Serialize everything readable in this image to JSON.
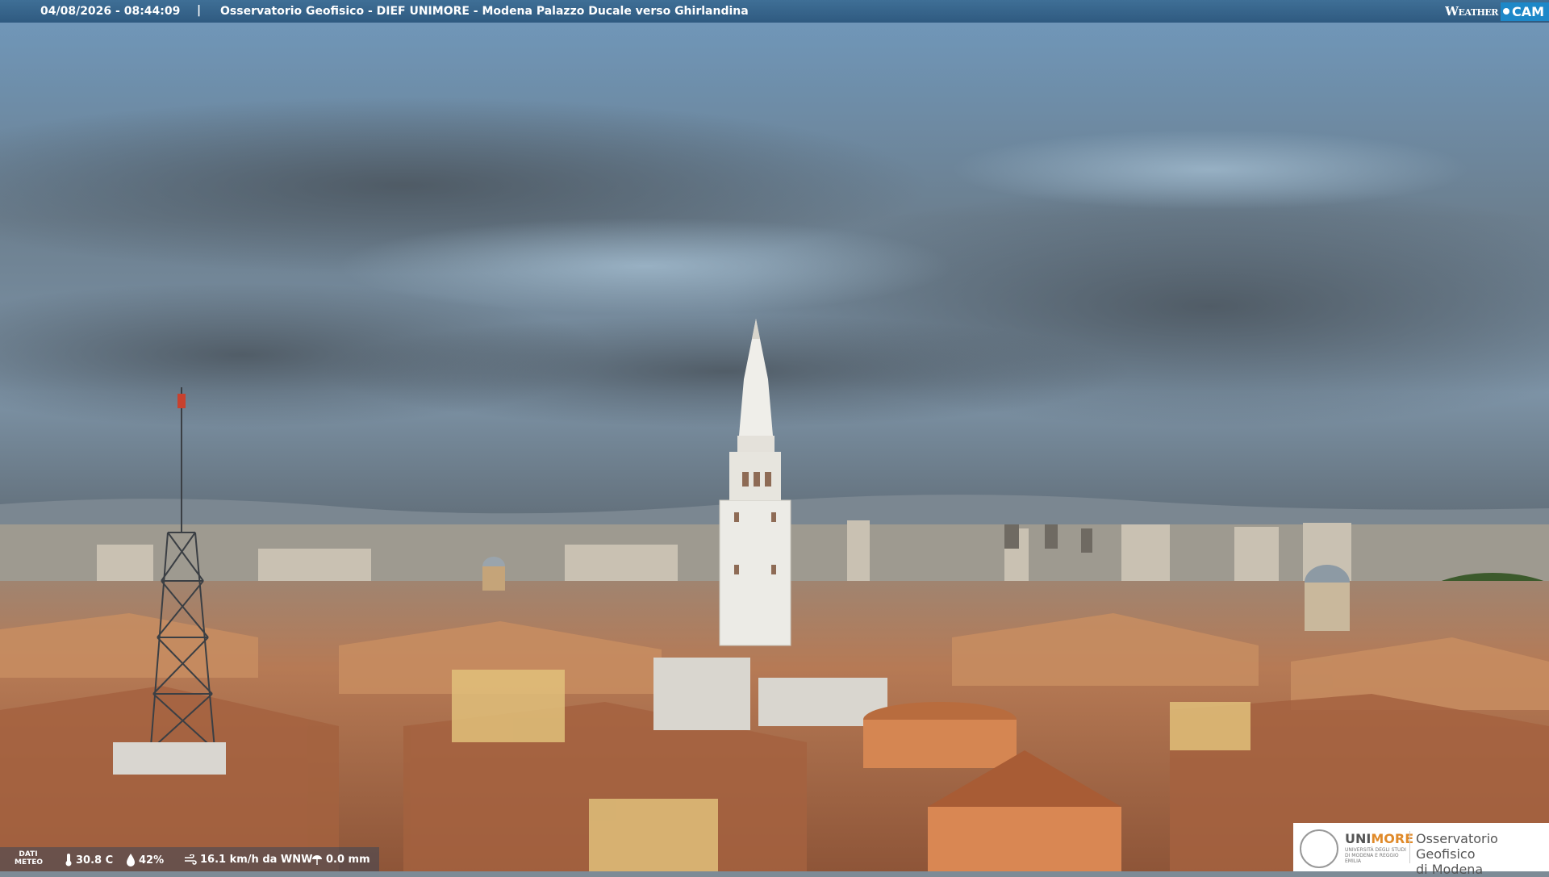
{
  "header": {
    "timestamp": "04/08/2026 - 08:44:09",
    "separator": "|",
    "title": "Osservatorio Geofisico - DIEF UNIMORE - Modena Palazzo Ducale verso Ghirlandina",
    "brand_weather": "Weather",
    "brand_cam": "CAM"
  },
  "weather": {
    "label": "DATI METEO",
    "temperature": "30.8 C",
    "humidity": "42%",
    "wind": "16.1 km/h da WNW",
    "rain": "0.0 mm",
    "icons": [
      "thermometer-icon",
      "humidity-drop-icon",
      "wind-icon",
      "rain-gauge-icon"
    ]
  },
  "logo": {
    "uni": "UNI",
    "more": "MORE",
    "subtitle": "UNIVERSITÀ DEGLI STUDI DI MODENA E REGGIO EMILIA",
    "observatory_line1": "Osservatorio Geofisico",
    "observatory_line2": "di Modena"
  },
  "colors": {
    "sky_top": "#6f95b8",
    "cloud": "#5b6670",
    "roofs": "#b5704c",
    "tower": "#ecebe6",
    "header_bar": "#34628a"
  }
}
